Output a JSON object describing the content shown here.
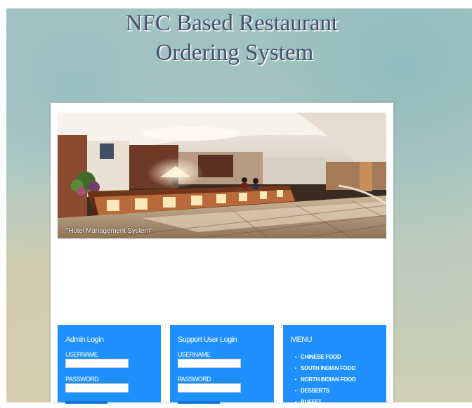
{
  "header": {
    "title_line1": "NFC Based Restaurant",
    "title_line2": "Ordering System"
  },
  "banner": {
    "caption": "\"Hotel Management System\""
  },
  "admin_login": {
    "title": "Admin Login",
    "username_label": "USERNAME",
    "username_value": "",
    "password_label": "PASSWORD",
    "password_value": ""
  },
  "support_login": {
    "title": "Support User Login",
    "username_label": "USERNAME",
    "username_value": "",
    "password_label": "PASSWORD",
    "password_value": ""
  },
  "menu": {
    "title": "MENU",
    "items": [
      {
        "label": "CHINESE FOOD"
      },
      {
        "label": "SOUTH INDIAN FOOD"
      },
      {
        "label": "NORTH INDIAN FOOD"
      },
      {
        "label": "DESSERTS"
      },
      {
        "label": "BUFFET"
      }
    ]
  },
  "colors": {
    "panel_blue": "#1e90ff",
    "title_text": "#44506c",
    "panel_background": "#ffffff"
  }
}
